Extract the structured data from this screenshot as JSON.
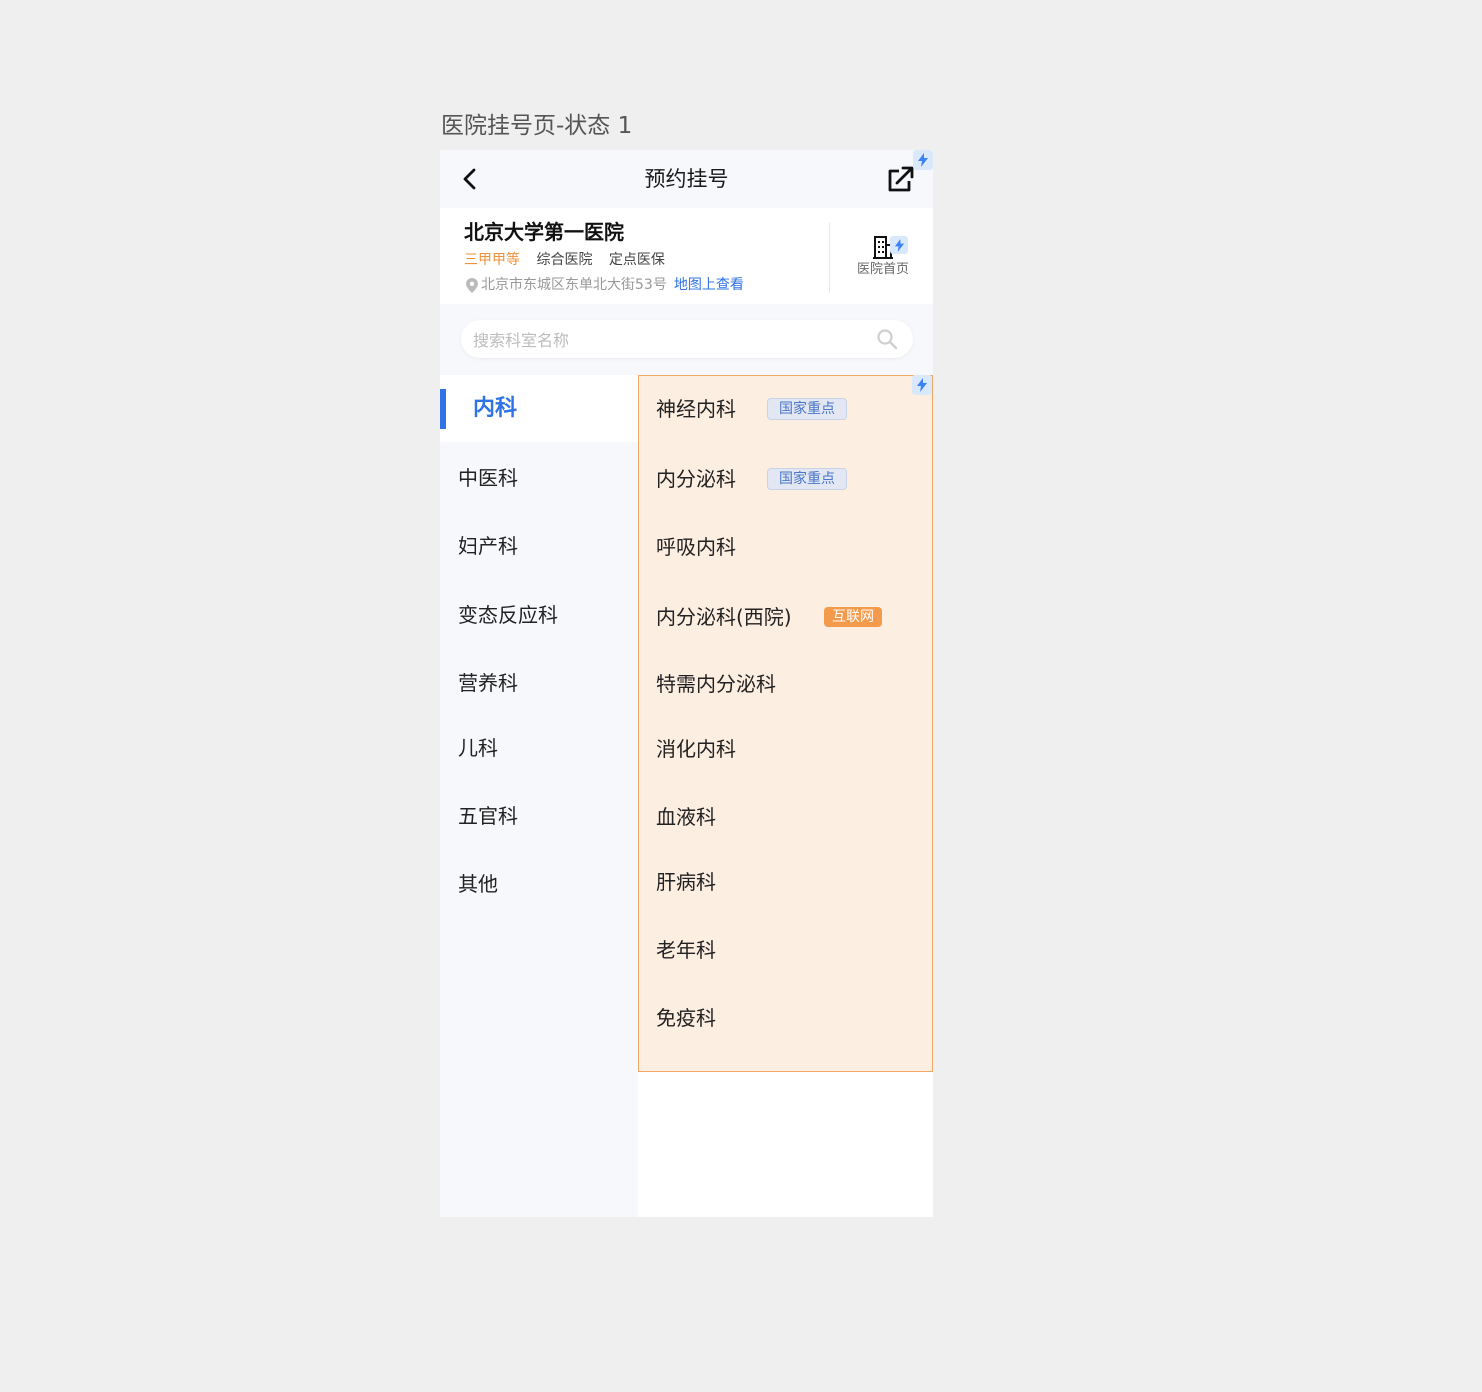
{
  "frame_label": "医院挂号页-状态 1",
  "nav": {
    "title": "预约挂号",
    "back_icon": "chevron-left-icon",
    "share_icon": "external-share-icon"
  },
  "hospital": {
    "name": "北京大学第一医院",
    "tags": [
      "三甲甲等",
      "综合医院",
      "定点医保"
    ],
    "address": "北京市东城区东单北大街53号",
    "map_link": "地图上查看",
    "home_label": "医院首页",
    "accent_color": "#2f73e6",
    "grade_color": "#f0913a"
  },
  "search": {
    "placeholder": "搜索科室名称"
  },
  "categories": [
    {
      "label": "内科",
      "active": true
    },
    {
      "label": "中医科"
    },
    {
      "label": "妇产科"
    },
    {
      "label": "变态反应科"
    },
    {
      "label": "营养科"
    },
    {
      "label": "儿科"
    },
    {
      "label": "五官科"
    },
    {
      "label": "其他"
    }
  ],
  "departments": [
    {
      "label": "神经内科",
      "badge": "国家重点"
    },
    {
      "label": "内分泌科",
      "badge": "国家重点"
    },
    {
      "label": "呼吸内科"
    },
    {
      "label": "内分泌科(西院)",
      "badge_net": "互联网"
    },
    {
      "label": "特需内分泌科"
    },
    {
      "label": "消化内科"
    },
    {
      "label": "血液科"
    },
    {
      "label": "肝病科"
    },
    {
      "label": "老年科"
    },
    {
      "label": "免疫科"
    }
  ]
}
